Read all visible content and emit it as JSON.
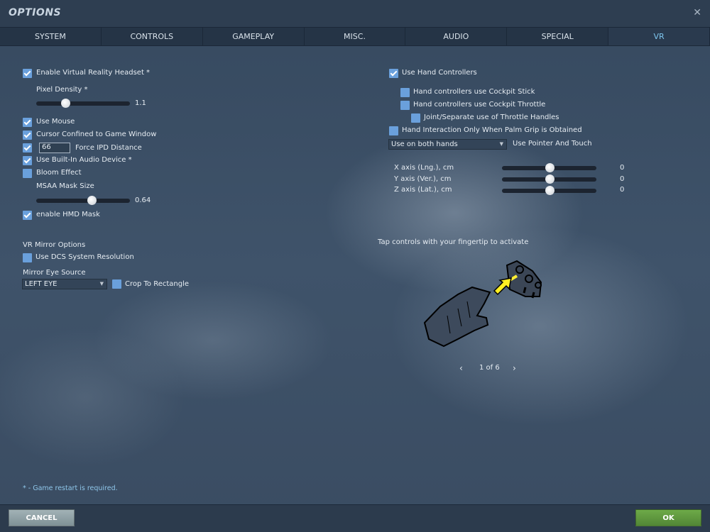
{
  "window": {
    "title": "OPTIONS",
    "close_icon": "close-icon"
  },
  "tabs": [
    {
      "label": "SYSTEM"
    },
    {
      "label": "CONTROLS"
    },
    {
      "label": "GAMEPLAY"
    },
    {
      "label": "MISC."
    },
    {
      "label": "AUDIO"
    },
    {
      "label": "SPECIAL"
    },
    {
      "label": "VR",
      "active": true
    }
  ],
  "left": {
    "enable_vr": {
      "label": "Enable Virtual Reality Headset *",
      "checked": true
    },
    "pixel_density": {
      "label": "Pixel Density *",
      "value": "1.1",
      "fraction": 0.31
    },
    "use_mouse": {
      "label": "Use Mouse",
      "checked": true
    },
    "cursor_confined": {
      "label": "Cursor Confined to Game Window",
      "checked": true
    },
    "force_ipd": {
      "label": "Force IPD Distance",
      "value": "66",
      "checked": true
    },
    "builtin_audio": {
      "label": "Use Built-In Audio Device *",
      "checked": true
    },
    "bloom": {
      "label": "Bloom Effect",
      "checked": false
    },
    "msaa_mask": {
      "label": "MSAA Mask Size",
      "value": "0.64",
      "fraction": 0.59
    },
    "hmd_mask": {
      "label": "enable HMD Mask",
      "checked": true
    },
    "mirror_heading": "VR Mirror Options",
    "dcs_resolution": {
      "label": "Use DCS System Resolution",
      "checked": false
    },
    "mirror_eye_label": "Mirror Eye Source",
    "mirror_eye_value": "LEFT EYE",
    "crop": {
      "label": "Crop To Rectangle",
      "checked": false
    }
  },
  "right": {
    "hand_controllers": {
      "label": "Use Hand Controllers",
      "checked": true
    },
    "cockpit_stick": {
      "label": "Hand controllers use Cockpit Stick",
      "checked": false
    },
    "cockpit_throttle": {
      "label": "Hand controllers use Cockpit Throttle",
      "checked": false
    },
    "throttle_handles": {
      "label": "Joint/Separate use of Throttle Handles",
      "checked": false
    },
    "palm_grip": {
      "label": "Hand Interaction Only When Palm Grip is Obtained",
      "checked": false
    },
    "hands_select": "Use on both hands",
    "pointer_label": "Use Pointer And Touch",
    "axes": [
      {
        "label": "X axis (Lng.), cm",
        "value": "0",
        "fraction": 0.5
      },
      {
        "label": "Y axis (Ver.), cm",
        "value": "0",
        "fraction": 0.5
      },
      {
        "label": "Z axis (Lat.), cm",
        "value": "0",
        "fraction": 0.5
      }
    ],
    "hint": "Tap controls with your fingertip to activate",
    "pager": "1 of 6"
  },
  "footer": {
    "note": "* - Game restart is required.",
    "cancel": "CANCEL",
    "ok": "OK"
  },
  "colors": {
    "accent": "#7ec6ee",
    "checkbox": "#6aa0dc",
    "ok": "#5e9a3c",
    "cancel": "#8fa1a6"
  }
}
